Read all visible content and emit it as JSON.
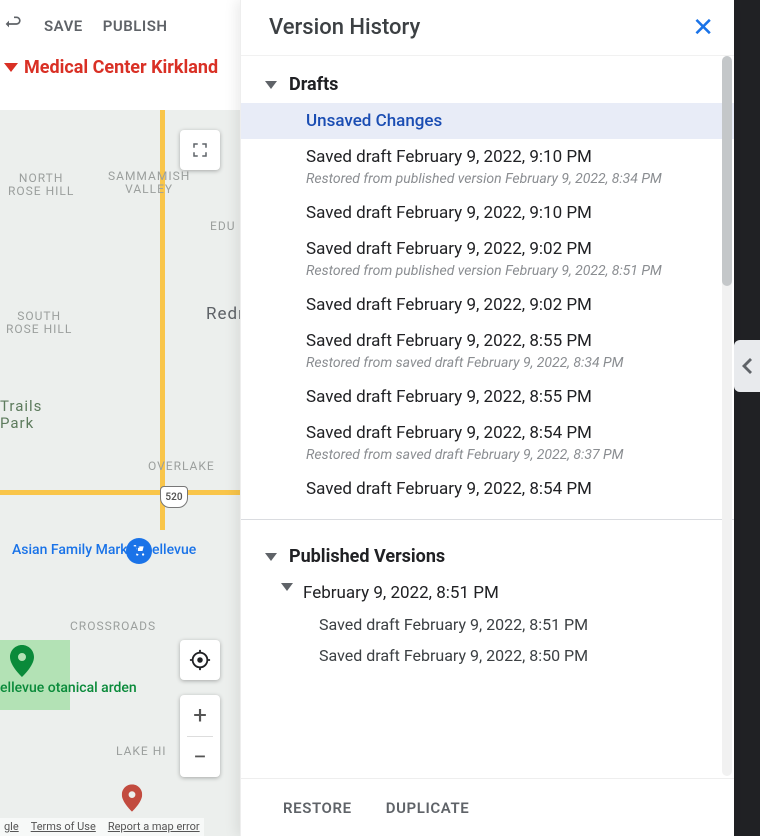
{
  "toolbar": {
    "save": "SAVE",
    "publish": "PUBLISH"
  },
  "location_name": "Medical Center Kirkland",
  "map": {
    "labels": {
      "north_rose_hill": "NORTH\nROSE HILL",
      "sammamish_valley": "SAMMAMISH\nVALLEY",
      "edu": "EDU",
      "south_rose_hill": "SOUTH\nROSE HILL",
      "redm": "Redm",
      "trails_park": "Trails\nPark",
      "overlake": "OVERLAKE",
      "crossroads": "CROSSROADS",
      "lake_hi": "LAKE HI",
      "botanical": "ellevue\notanical\narden",
      "asian_market": "Asian Family\nMarket Bellevue"
    },
    "shields": {
      "r520": "520"
    },
    "footer": {
      "gle": "gle",
      "terms": "Terms of Use",
      "report": "Report a map error"
    }
  },
  "version_history": {
    "title": "Version History",
    "drafts_label": "Drafts",
    "published_label": "Published Versions",
    "footer": {
      "restore": "RESTORE",
      "duplicate": "DUPLICATE"
    },
    "drafts": [
      {
        "label": "Unsaved Changes",
        "selected": true
      },
      {
        "label": "Saved draft February 9, 2022, 9:10 PM",
        "sub": "Restored from published version February 9, 2022, 8:34 PM"
      },
      {
        "label": "Saved draft February 9, 2022, 9:10 PM"
      },
      {
        "label": "Saved draft February 9, 2022, 9:02 PM",
        "sub": "Restored from published version February 9, 2022, 8:51 PM"
      },
      {
        "label": "Saved draft February 9, 2022, 9:02 PM"
      },
      {
        "label": "Saved draft February 9, 2022, 8:55 PM",
        "sub": "Restored from saved draft February 9, 2022, 8:34 PM"
      },
      {
        "label": "Saved draft February 9, 2022, 8:55 PM"
      },
      {
        "label": "Saved draft February 9, 2022, 8:54 PM",
        "sub": "Restored from saved draft February 9, 2022, 8:37 PM"
      },
      {
        "label": "Saved draft February 9, 2022, 8:54 PM"
      }
    ],
    "published": [
      {
        "label": "February 9, 2022, 8:51 PM",
        "children": [
          {
            "label": "Saved draft February 9, 2022, 8:51 PM"
          },
          {
            "label": "Saved draft February 9, 2022, 8:50 PM"
          }
        ]
      }
    ]
  }
}
